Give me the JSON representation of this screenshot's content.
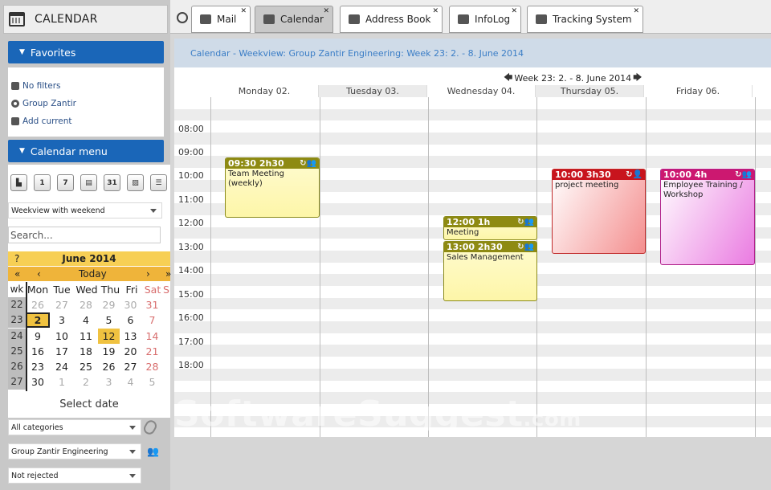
{
  "app": {
    "title": "CALENDAR"
  },
  "tabs": [
    {
      "label": "Mail"
    },
    {
      "label": "Calendar"
    },
    {
      "label": "Address Book"
    },
    {
      "label": "InfoLog"
    },
    {
      "label": "Tracking System"
    }
  ],
  "favorites": {
    "header": "Favorites",
    "items": [
      "No filters",
      "Group Zantir",
      "Add current"
    ]
  },
  "calendar_menu": {
    "header": "Calendar menu",
    "view_select": "Weekview with weekend",
    "search_placeholder": "Search...",
    "mini_calendar": {
      "help": "?",
      "month": "June 2014",
      "nav_prev_prev": "«",
      "nav_prev": "‹",
      "today": "Today",
      "nav_next": "›",
      "nav_next_next": "»",
      "weekday_headers": [
        "wk",
        "Mon",
        "Tue",
        "Wed",
        "Thu",
        "Fri",
        "Sat",
        "Su"
      ],
      "weeks": [
        {
          "wk": "22",
          "days": [
            "26",
            "27",
            "28",
            "29",
            "30",
            "31"
          ]
        },
        {
          "wk": "23",
          "days": [
            "2",
            "3",
            "4",
            "5",
            "6",
            "7"
          ]
        },
        {
          "wk": "24",
          "days": [
            "9",
            "10",
            "11",
            "12",
            "13",
            "14"
          ]
        },
        {
          "wk": "25",
          "days": [
            "16",
            "17",
            "18",
            "19",
            "20",
            "21"
          ]
        },
        {
          "wk": "26",
          "days": [
            "23",
            "24",
            "25",
            "26",
            "27",
            "28"
          ]
        },
        {
          "wk": "27",
          "days": [
            "30",
            "1",
            "2",
            "3",
            "4",
            "5"
          ]
        }
      ]
    },
    "select_date": "Select date",
    "categories_select": "All categories",
    "owner_select": "Group Zantir Engineering",
    "filter_select": "Not rejected"
  },
  "main": {
    "breadcrumb": "Calendar - Weekview: Group Zantir Engineering: Week 23: 2. - 8. June 2014",
    "week_label": "Week 23: 2. - 8. June 2014",
    "days": [
      "Monday 02.",
      "Tuesday 03.",
      "Wednesday 04.",
      "Thursday 05.",
      "Friday 06."
    ],
    "hours": [
      "08:00",
      "09:00",
      "10:00",
      "11:00",
      "12:00",
      "13:00",
      "14:00",
      "15:00",
      "16:00",
      "17:00",
      "18:00"
    ],
    "events": [
      {
        "time": "09:30 2h30",
        "title": "Team Meeting (weekly)",
        "color": "olive"
      },
      {
        "time": "12:00 1h",
        "title": "Meeting",
        "color": "olive"
      },
      {
        "time": "13:00 2h30",
        "title": "Sales Management",
        "color": "olive"
      },
      {
        "time": "10:00 3h30",
        "title": "project meeting",
        "color": "red"
      },
      {
        "time": "10:00 4h",
        "title": "Employee Training / Workshop",
        "color": "pink"
      }
    ]
  },
  "watermark": {
    "text": "SoftwareSuggest",
    "suffix": ".com"
  }
}
